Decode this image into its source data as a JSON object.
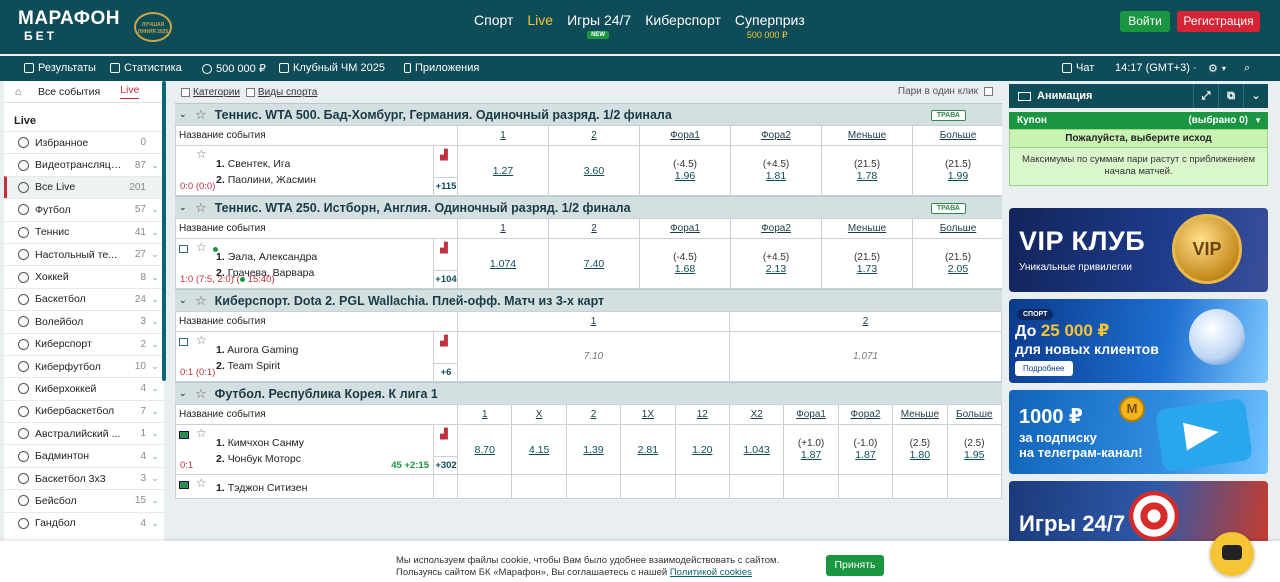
{
  "header": {
    "logo_line1": "МАРАФОН",
    "logo_line2": "БЕТ",
    "award_text": "ЛУЧШАЯ ЛИНИЯ 2025",
    "nav": [
      {
        "label": "Спорт"
      },
      {
        "label": "Live",
        "active": true
      },
      {
        "label": "Игры 24/7",
        "badge": "NEW"
      },
      {
        "label": "Киберспорт"
      },
      {
        "label": "Суперприз",
        "sub": "500 000 ₽"
      }
    ],
    "login_label": "Войти",
    "register_label": "Регистрация"
  },
  "subbar": {
    "results": "Результаты",
    "stats": "Статистика",
    "bonus": "500 000 ₽",
    "club": "Клубный ЧМ 2025",
    "apps": "Приложения",
    "chat": "Чат",
    "time": "14:17 (GMT+3) ·"
  },
  "sidebar": {
    "tab_all": "Все события",
    "tab_live": "Live",
    "section": "Live",
    "items": [
      {
        "label": "Избранное",
        "count": "0"
      },
      {
        "label": "Видеотрансляция",
        "count": "87"
      },
      {
        "label": "Все Live",
        "count": "201"
      },
      {
        "label": "Футбол",
        "count": "57"
      },
      {
        "label": "Теннис",
        "count": "41"
      },
      {
        "label": "Настольный те...",
        "count": "27"
      },
      {
        "label": "Хоккей",
        "count": "8"
      },
      {
        "label": "Баскетбол",
        "count": "24"
      },
      {
        "label": "Волейбол",
        "count": "3"
      },
      {
        "label": "Киберспорт",
        "count": "2"
      },
      {
        "label": "Киберфутбол",
        "count": "10"
      },
      {
        "label": "Киберхоккей",
        "count": "4"
      },
      {
        "label": "Кибербаскетбол",
        "count": "7"
      },
      {
        "label": "Австралийский ...",
        "count": "1"
      },
      {
        "label": "Бадминтон",
        "count": "4"
      },
      {
        "label": "Баскетбол 3х3",
        "count": "3"
      },
      {
        "label": "Бейсбол",
        "count": "15"
      },
      {
        "label": "Гандбол",
        "count": "4"
      }
    ]
  },
  "main": {
    "categories_label": "Категории",
    "sports_label": "Виды спорта",
    "one_click_label": "Пари в один клик",
    "event_name_header": "Название события",
    "surface": "ТРАВА",
    "groups": [
      {
        "title": "Теннис. WTA 500. Бад-Хомбург, Германия. Одиночный разряд. 1/2 финала",
        "headers": [
          "1",
          "2",
          "Фора1",
          "Фора2",
          "Меньше",
          "Больше"
        ],
        "p1": "Свентек, Ига",
        "p2": "Паолини, Жасмин",
        "score": "0:0 (0:0)",
        "more": "+115",
        "odds": [
          {
            "v": "1.27"
          },
          {
            "v": "3.60"
          },
          {
            "h": "(-4.5)",
            "v": "1.96"
          },
          {
            "h": "(+4.5)",
            "v": "1.81"
          },
          {
            "h": "(21.5)",
            "v": "1.78"
          },
          {
            "h": "(21.5)",
            "v": "1.99"
          }
        ]
      },
      {
        "title": "Теннис. WTA 250. Истборн, Англия. Одиночный разряд. 1/2 финала",
        "headers": [
          "1",
          "2",
          "Фора1",
          "Фора2",
          "Меньше",
          "Больше"
        ],
        "p1": "Эала, Александра",
        "p2": "Грачева, Варвара",
        "score": "1:0 (7:5, 2:0) (",
        "score_time": "15:40)",
        "more": "+104",
        "odds": [
          {
            "v": "1.074"
          },
          {
            "v": "7.40"
          },
          {
            "h": "(-4.5)",
            "v": "1.68"
          },
          {
            "h": "(+4.5)",
            "v": "2.13"
          },
          {
            "h": "(21.5)",
            "v": "1.73"
          },
          {
            "h": "(21.5)",
            "v": "2.05"
          }
        ]
      },
      {
        "title": "Киберспорт. Dota 2. PGL Wallachia. Плей-офф. Матч из 3-х карт",
        "headers": [
          "1",
          "2"
        ],
        "p1": "Aurora Gaming",
        "p2": "Team Spirit",
        "score": "0:1 (0:1)",
        "more": "+6",
        "odds": [
          {
            "v": "7.10"
          },
          {
            "v": "1.071"
          }
        ]
      },
      {
        "title": "Футбол. Республика Корея. К лига 1",
        "headers": [
          "1",
          "X",
          "2",
          "1X",
          "12",
          "X2",
          "Фора1",
          "Фора2",
          "Меньше",
          "Больше"
        ],
        "p1": "Кимчхон Санму",
        "p2": "Чонбук Моторс",
        "score": "0:1",
        "live_time": "45 +2:15",
        "more": "+302",
        "odds": [
          {
            "v": "8.70"
          },
          {
            "v": "4.15"
          },
          {
            "v": "1.39"
          },
          {
            "v": "2.81"
          },
          {
            "v": "1.20"
          },
          {
            "v": "1.043"
          },
          {
            "h": "(+1.0)",
            "v": "1.87"
          },
          {
            "h": "(-1.0)",
            "v": "1.87"
          },
          {
            "h": "(2.5)",
            "v": "1.80"
          },
          {
            "h": "(2.5)",
            "v": "1.95"
          }
        ],
        "next_p1": "Тэджон Ситизен"
      }
    ]
  },
  "right": {
    "animation_label": "Анимация",
    "coupon_label": "Купон",
    "coupon_count": "(выбрано 0)",
    "choose_outcome": "Пожалуйста, выберите исход",
    "max_note": "Максимумы по суммам пари растут с приближением начала матчей.",
    "banner1_title": "VIP КЛУБ",
    "banner1_sub": "Уникальные привилегии",
    "banner1_coin": "VIP",
    "banner2_tag": "СПОРТ",
    "banner2_pre": "До ",
    "banner2_amount": "25 000 ₽",
    "banner2_line2": "для новых клиентов",
    "banner2_btn": "Подробнее",
    "banner3_title": "1000 ₽",
    "banner3_l1": "за подписку",
    "banner3_l2": "на телеграм-канал!",
    "banner3_coin": "М",
    "banner4_title": "Игры 24/7"
  },
  "cookie": {
    "line1": "Мы используем файлы cookie, чтобы Вам было удобнее взаимодействовать с сайтом.",
    "line2": "Пользуясь сайтом БК «Марафон», Вы соглашаетесь с нашей ",
    "link": "Политикой cookies",
    "accept": "Принять"
  }
}
